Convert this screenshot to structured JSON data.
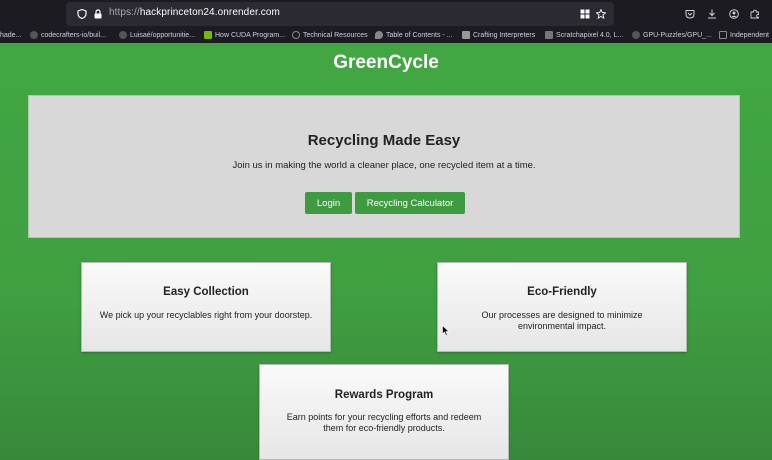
{
  "browser": {
    "url_protocol": "https://",
    "url_host": "hackprinceton24.onrender.com",
    "bookmarks": [
      {
        "label": "hade...",
        "color": "#6b6b73"
      },
      {
        "label": "codecrafters-io/buil...",
        "color": "#555"
      },
      {
        "label": "Luisaé/opportunitie...",
        "color": "#555"
      },
      {
        "label": "How CUDA Program...",
        "color": "#76b900"
      },
      {
        "label": "Technical Resources",
        "color": "#888"
      },
      {
        "label": "Table of Contents - ...",
        "color": "#888"
      },
      {
        "label": "Crafting Interpreters",
        "color": "#999"
      },
      {
        "label": "Scratchapixel 4.0, L...",
        "color": "#777"
      },
      {
        "label": "GPU-Puzzles/GPU_...",
        "color": "#555"
      },
      {
        "label": "Independent",
        "color": "#888"
      }
    ]
  },
  "site": {
    "title": "GreenCycle",
    "hero": {
      "heading": "Recycling Made Easy",
      "subtitle": "Join us in making the world a cleaner place, one recycled item at a time.",
      "login_label": "Login",
      "calculator_label": "Recycling Calculator"
    },
    "features": [
      {
        "title": "Easy Collection",
        "text": "We pick up your recyclables right from your doorstep."
      },
      {
        "title": "Eco-Friendly",
        "text": "Our processes are designed to minimize environmental impact."
      },
      {
        "title": "Rewards Program",
        "text": "Earn points for your recycling efforts and redeem them for eco-friendly products."
      }
    ]
  },
  "colors": {
    "background": "#41a043",
    "button": "#3f9b41",
    "hero_bg": "#d8d8d8"
  }
}
